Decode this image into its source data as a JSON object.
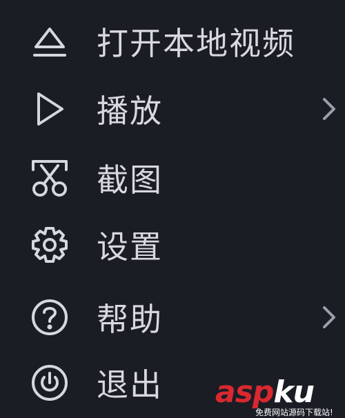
{
  "menu": {
    "items": [
      {
        "label": "打开本地视频",
        "icon": "eject-open-icon",
        "has_submenu": false
      },
      {
        "label": "播放",
        "icon": "play-icon",
        "has_submenu": true
      },
      {
        "label": "截图",
        "icon": "scissors-icon",
        "has_submenu": false
      },
      {
        "label": "设置",
        "icon": "gear-icon",
        "has_submenu": false
      },
      {
        "label": "帮助",
        "icon": "help-icon",
        "has_submenu": true
      },
      {
        "label": "退出",
        "icon": "power-icon",
        "has_submenu": false
      }
    ]
  },
  "watermark": {
    "brand_red": "asp",
    "brand_white": "ku",
    "tagline": "免费网站源码下载站!"
  },
  "colors": {
    "background": "#1b1d25",
    "text": "#d7d9de",
    "icon": "#d5d8df",
    "brand_red": "#d9282f"
  }
}
